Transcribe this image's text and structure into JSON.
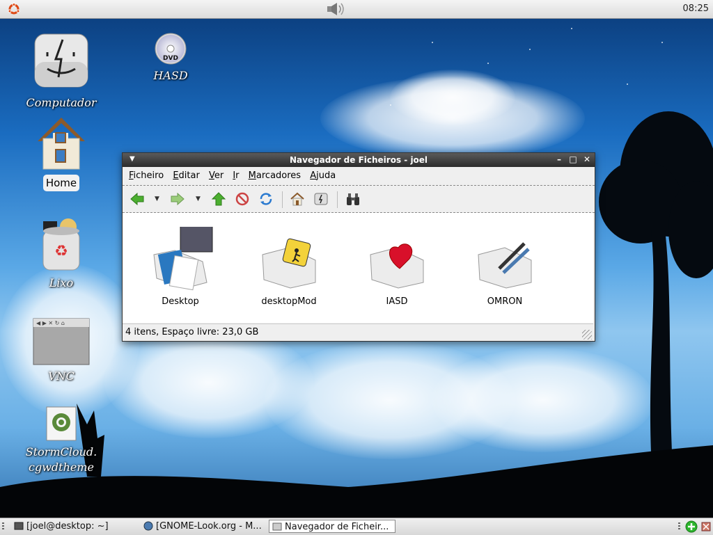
{
  "top_panel": {
    "clock": "08:25",
    "icons": [
      "ubuntu-logo-icon",
      "volume-icon"
    ]
  },
  "desktop": {
    "icons": [
      {
        "label": "Computador",
        "icon": "computer-finder-icon"
      },
      {
        "label": "HASD",
        "icon": "dvd-icon"
      },
      {
        "label": "Home",
        "icon": "home-icon",
        "selected": true
      },
      {
        "label": "Lixo",
        "icon": "trash-icon"
      },
      {
        "label": "VNC",
        "icon": "vnc-window-icon"
      },
      {
        "label": "StormCloud.",
        "label2": "cgwdtheme",
        "icon": "theme-file-icon"
      }
    ]
  },
  "window": {
    "title": "Navegador de Ficheiros - joel",
    "menu": [
      "Ficheiro",
      "Editar",
      "Ver",
      "Ir",
      "Marcadores",
      "Ajuda"
    ],
    "toolbar": [
      "back-icon",
      "forward-icon",
      "up-icon",
      "stop-icon",
      "reload-icon",
      "home-icon",
      "computer-icon",
      "search-binoculars-icon"
    ],
    "files": [
      {
        "name": "Desktop",
        "icon": "documents-folder-icon"
      },
      {
        "name": "desktopMod",
        "icon": "public-folder-icon"
      },
      {
        "name": "IASD",
        "icon": "favorite-folder-icon"
      },
      {
        "name": "OMRON",
        "icon": "pen-folder-icon"
      }
    ],
    "status": "4 itens, Espaço livre: 23,0 GB"
  },
  "taskbar": {
    "tasks": [
      {
        "label": "[joel@desktop: ~]",
        "active": false
      },
      {
        "label": "[GNOME-Look.org - M...",
        "active": false
      },
      {
        "label": "Navegador de Ficheir...",
        "active": true
      }
    ]
  },
  "colors": {
    "sky_top": "#0a3a78",
    "sky_mid": "#5aa8e6",
    "titlebar": "#2c2c2c",
    "accent_green": "#2db52d"
  }
}
